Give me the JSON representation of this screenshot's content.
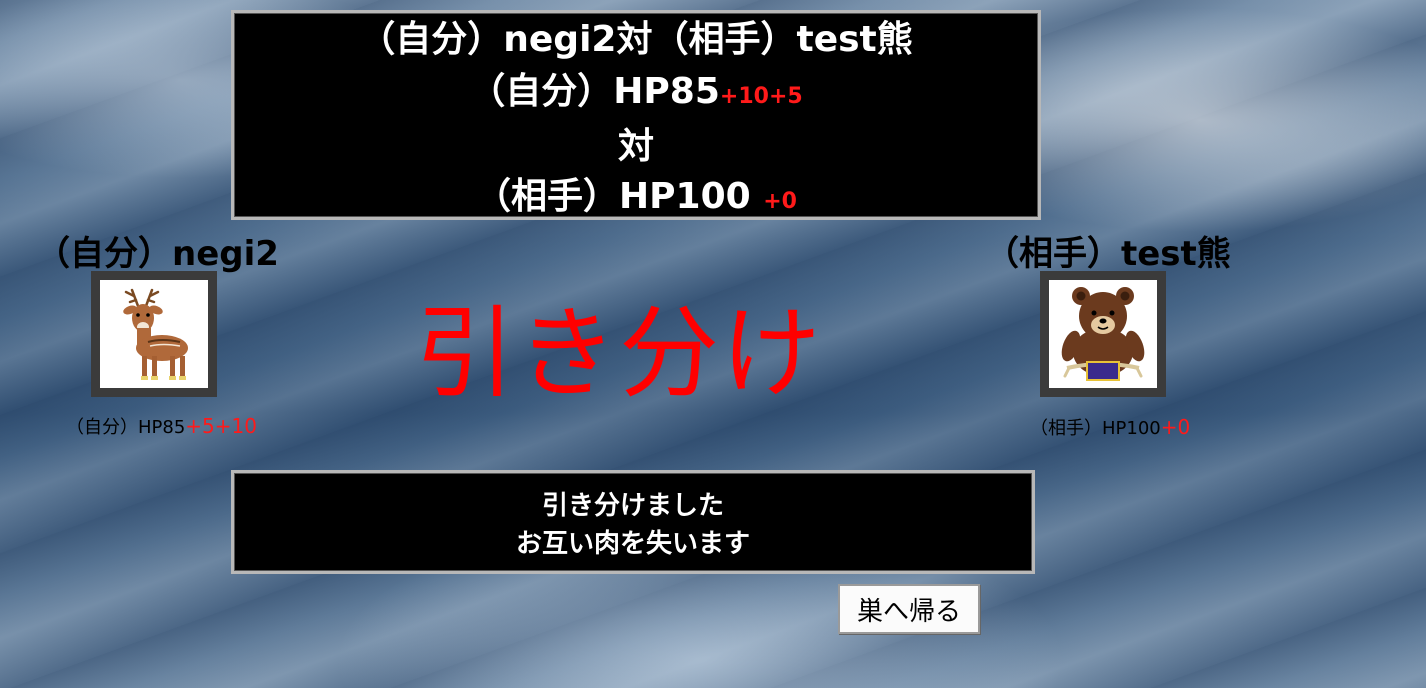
{
  "header": {
    "title_self": "（自分）negi2",
    "title_vs": "対",
    "title_opponent": "（相手）test熊",
    "self_hp": "（自分）HP85",
    "self_bonus": "+10+5",
    "vs": "対",
    "opponent_hp": "（相手）HP100",
    "opponent_bonus": "+0"
  },
  "player": {
    "name": "（自分）negi2",
    "hp": "（自分）HP85",
    "bonus": "+5+10",
    "icon": "deer-icon"
  },
  "opponent": {
    "name": "（相手）test熊",
    "hp": "（相手）HP100",
    "bonus": "+0",
    "icon": "bear-icon"
  },
  "result": "引き分け",
  "message": {
    "line1": "引き分けました",
    "line2": "お互い肉を失います"
  },
  "buttons": {
    "return_home": "巣へ帰る"
  },
  "colors": {
    "accent_red": "#ff1a1a",
    "panel_bg": "#000000"
  }
}
